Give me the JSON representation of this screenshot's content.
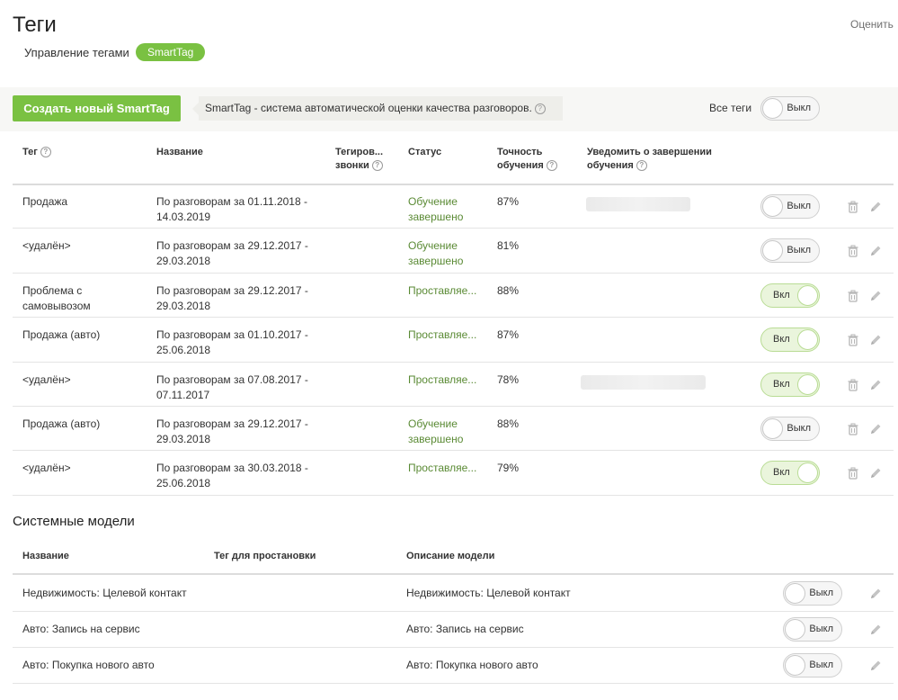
{
  "page": {
    "title": "Теги",
    "rate_label": "Оценить"
  },
  "tabs": [
    {
      "label": "Управление тегами",
      "active": false
    },
    {
      "label": "SmartTag",
      "active": true
    }
  ],
  "toolbar": {
    "create_button": "Создать новый SmartTag",
    "info_text": "SmartTag - система автоматической оценки качества разговоров.",
    "all_tags_label": "Все теги",
    "all_tags_toggle": "Выкл"
  },
  "smarttags": {
    "headers": {
      "tag": "Тег",
      "name": "Название",
      "tagged_1": "Тегиров...",
      "tagged_2": "звонки",
      "status": "Статус",
      "accuracy_1": "Точность",
      "accuracy_2": "обучения",
      "notify_1": "Уведомить о завершении",
      "notify_2": "обучения"
    },
    "rows": [
      {
        "tag": "Продажа",
        "name1": "По разговорам за 01.11.2018 -",
        "name2": "14.03.2019",
        "status1": "Обучение",
        "status2": "завершено",
        "accuracy": "87%",
        "toggle": "Выкл",
        "on": false
      },
      {
        "tag": "<удалён>",
        "name1": "По разговорам за 29.12.2017 -",
        "name2": "29.03.2018",
        "status1": "Обучение",
        "status2": "завершено",
        "accuracy": "81%",
        "toggle": "Выкл",
        "on": false
      },
      {
        "tag": "Проблема с",
        "tag2": "самовывозом",
        "name1": "По разговорам за 29.12.2017 -",
        "name2": "29.03.2018",
        "status1": "Проставляе...",
        "accuracy": "88%",
        "toggle": "Вкл",
        "on": true
      },
      {
        "tag": "Продажа (авто)",
        "name1": "По разговорам за 01.10.2017 -",
        "name2": "25.06.2018",
        "status1": "Проставляе...",
        "accuracy": "87%",
        "toggle": "Вкл",
        "on": true
      },
      {
        "tag": "<удалён>",
        "name1": "По разговорам за 07.08.2017 -",
        "name2": "07.11.2017",
        "status1": "Проставляе...",
        "accuracy": "78%",
        "toggle": "Вкл",
        "on": true
      },
      {
        "tag": "Продажа (авто)",
        "name1": "По разговорам за 29.12.2017 -",
        "name2": "29.03.2018",
        "status1": "Обучение",
        "status2": "завершено",
        "accuracy": "88%",
        "toggle": "Выкл",
        "on": false
      },
      {
        "tag": "<удалён>",
        "name1": "По разговорам за 30.03.2018 -",
        "name2": "25.06.2018",
        "status1": "Проставляе...",
        "accuracy": "79%",
        "toggle": "Вкл",
        "on": true
      }
    ]
  },
  "system": {
    "title": "Системные модели",
    "headers": {
      "name": "Название",
      "tag": "Тег для простановки",
      "desc": "Описание модели"
    },
    "rows": [
      {
        "name": "Недвижимость: Целевой контакт",
        "desc": "Недвижимость: Целевой контакт",
        "toggle": "Выкл"
      },
      {
        "name": "Авто: Запись на сервис",
        "desc": "Авто: Запись на сервис",
        "toggle": "Выкл"
      },
      {
        "name": "Авто: Покупка нового авто",
        "desc": "Авто: Покупка нового авто",
        "toggle": "Выкл"
      }
    ]
  }
}
